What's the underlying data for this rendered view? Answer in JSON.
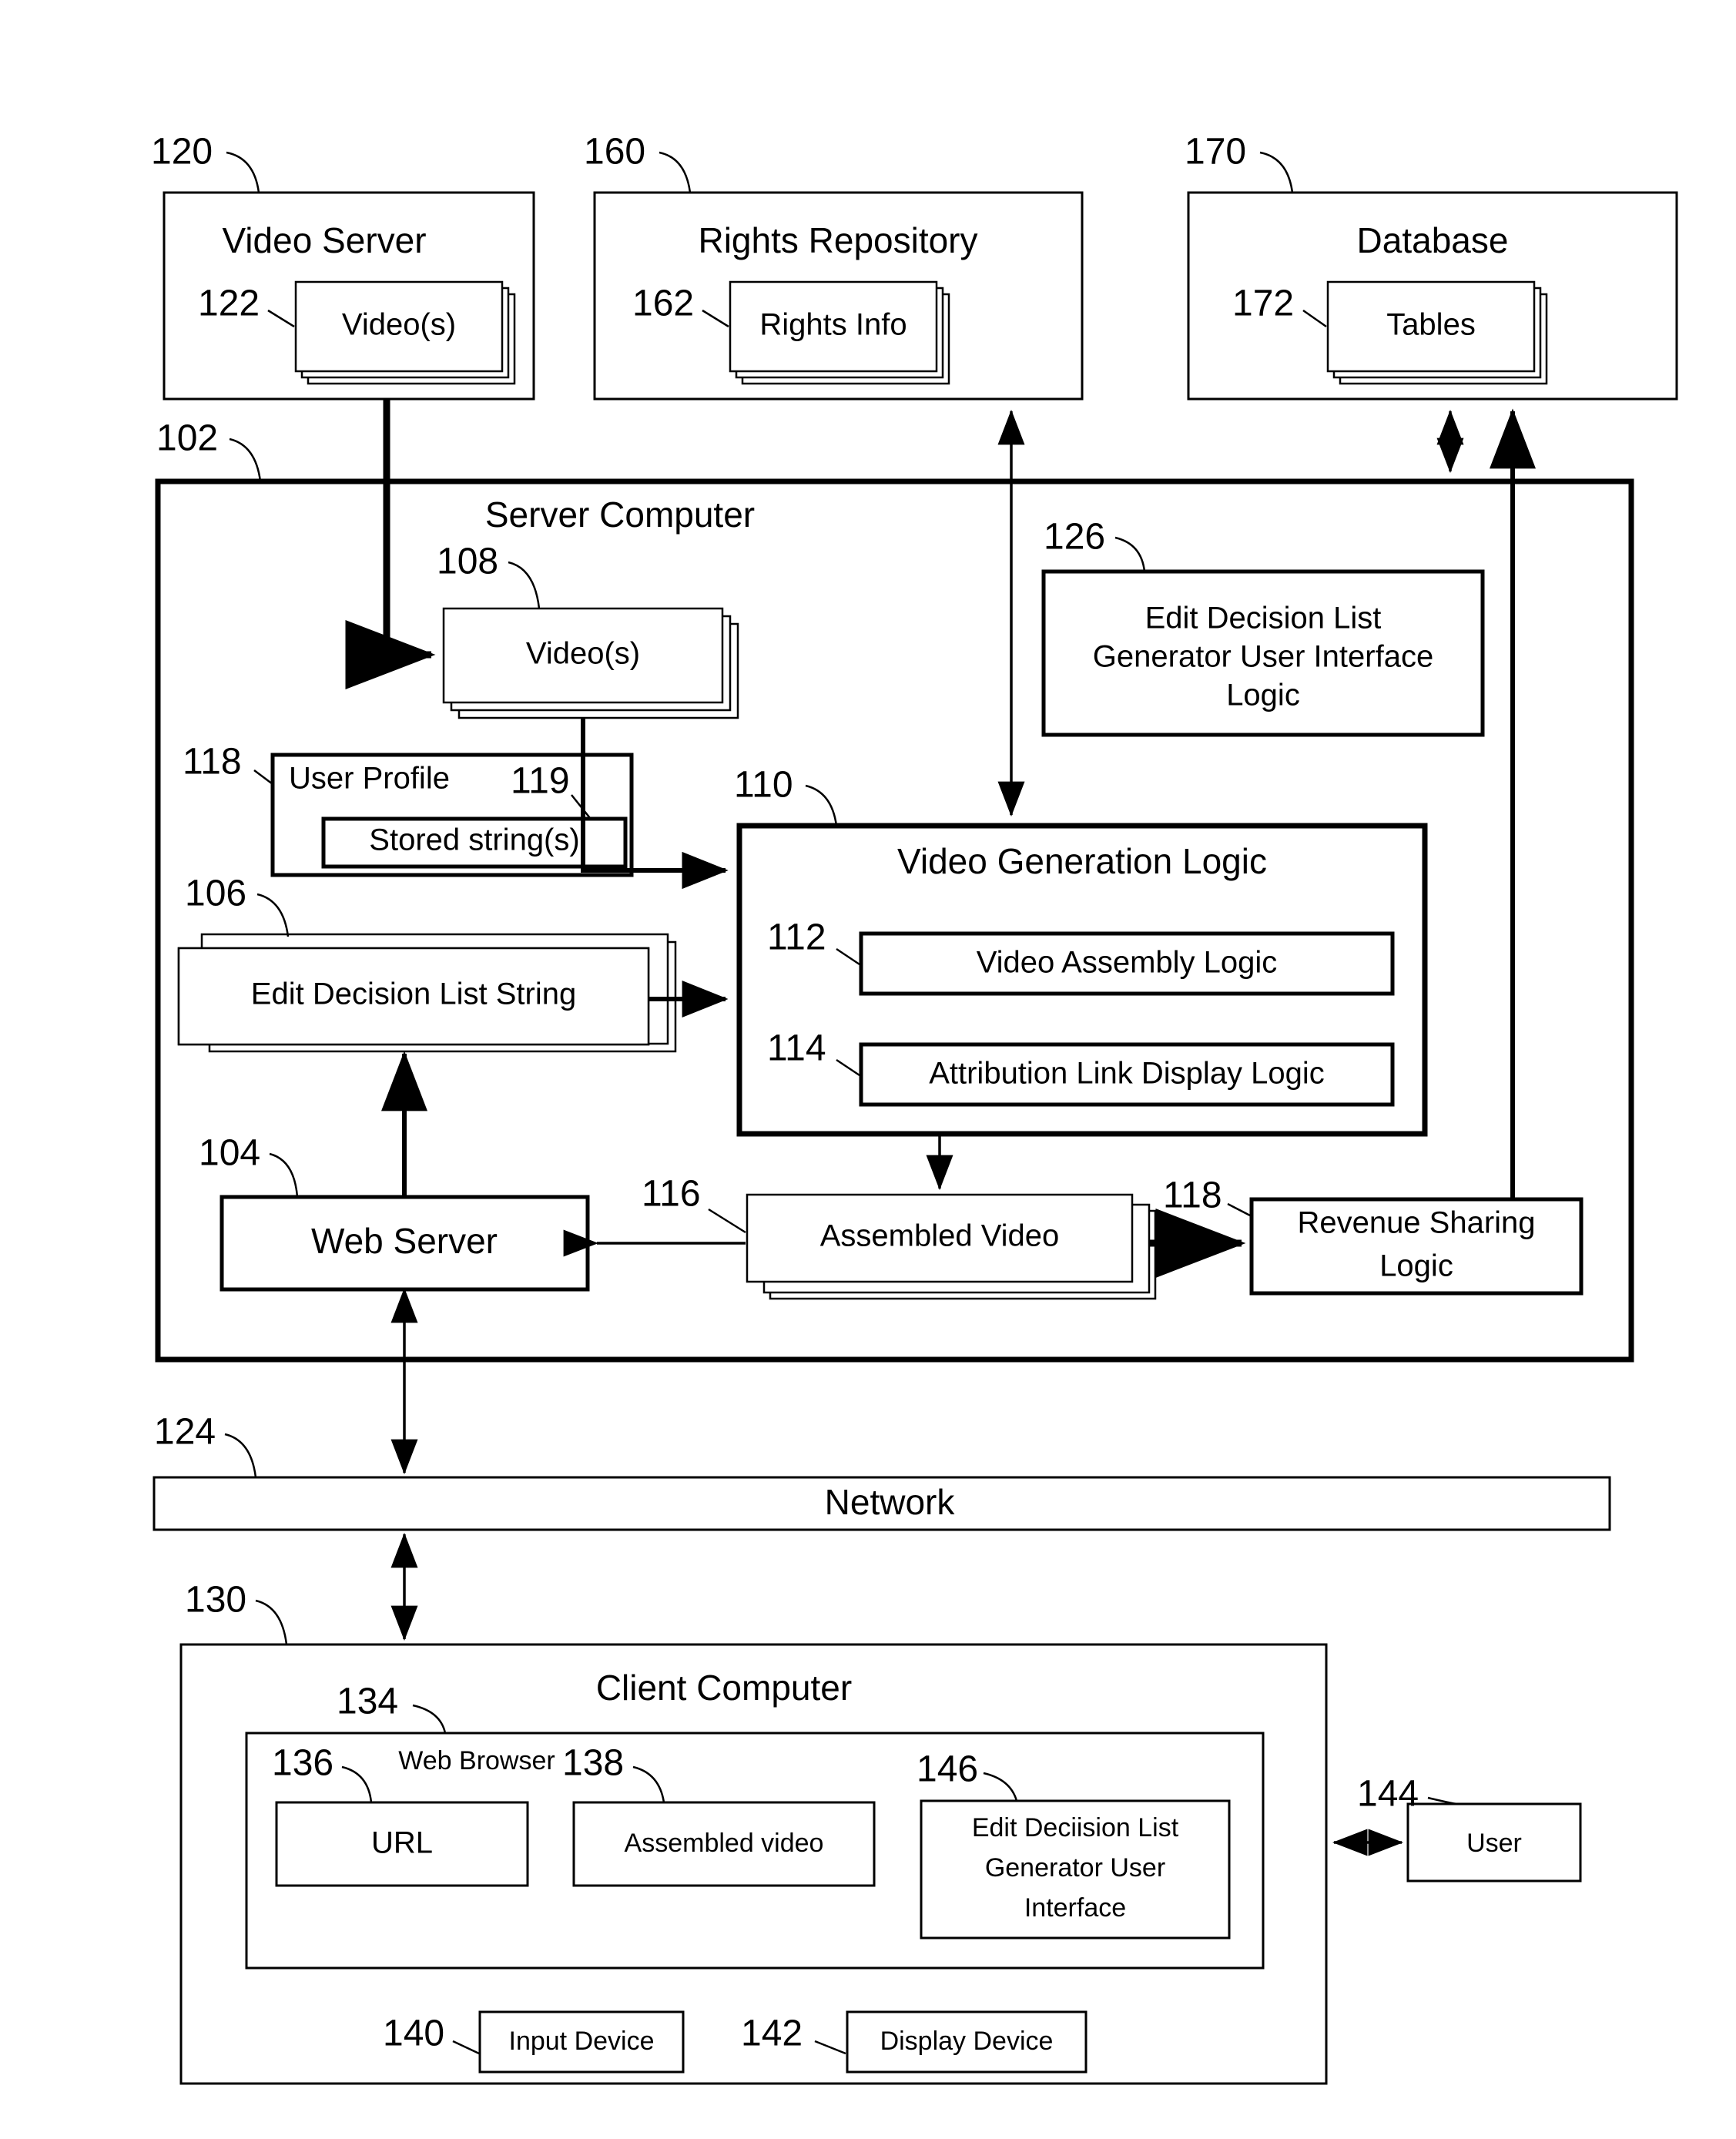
{
  "figure": {
    "title": "Video generation system block diagram",
    "stroke_color": "#000000",
    "background_color": "#ffffff"
  },
  "nodes": {
    "video_server": {
      "ref": "120",
      "label": "Video Server"
    },
    "videos_source": {
      "ref": "122",
      "label": "Video(s)"
    },
    "rights_repository": {
      "ref": "160",
      "label": "Rights Repository"
    },
    "rights_info": {
      "ref": "162",
      "label": "Rights Info"
    },
    "database": {
      "ref": "170",
      "label": "Database"
    },
    "tables": {
      "ref": "172",
      "label": "Tables"
    },
    "server_computer": {
      "ref": "102",
      "label": "Server Computer"
    },
    "videos_server_copy": {
      "ref": "108",
      "label": "Video(s)"
    },
    "edl_generator_ui_logic": {
      "ref": "126",
      "line1": "Edit Decision List",
      "line2": "Generator User Interface",
      "line3": "Logic"
    },
    "user_profile": {
      "ref": "118",
      "label": "User Profile"
    },
    "stored_strings": {
      "ref": "119",
      "label": "Stored string(s)"
    },
    "edl_string": {
      "ref": "106",
      "label": "Edit Decision List String"
    },
    "video_generation_logic": {
      "ref": "110",
      "label": "Video Generation Logic"
    },
    "video_assembly_logic": {
      "ref": "112",
      "label": "Video Assembly Logic"
    },
    "attribution_link_logic": {
      "ref": "114",
      "label": "Attribution Link Display Logic"
    },
    "web_server": {
      "ref": "104",
      "label": "Web Server"
    },
    "assembled_video": {
      "ref": "116",
      "label": "Assembled Video"
    },
    "revenue_sharing_logic": {
      "ref": "118",
      "line1": "Revenue Sharing",
      "line2": "Logic"
    },
    "network": {
      "ref": "124",
      "label": "Network"
    },
    "client_computer": {
      "ref": "130",
      "label": "Client Computer"
    },
    "web_browser": {
      "ref": "134",
      "label": "Web Browser"
    },
    "url": {
      "ref": "136",
      "label": "URL"
    },
    "assembled_video_client": {
      "ref": "138",
      "label": "Assembled video"
    },
    "edl_generator_ui": {
      "ref": "146",
      "line1": "Edit Deciision List",
      "line2": "Generator User",
      "line3": "Interface"
    },
    "input_device": {
      "ref": "140",
      "label": "Input Device"
    },
    "display_device": {
      "ref": "142",
      "label": "Display Device"
    },
    "user": {
      "ref": "144",
      "label": "User"
    }
  }
}
